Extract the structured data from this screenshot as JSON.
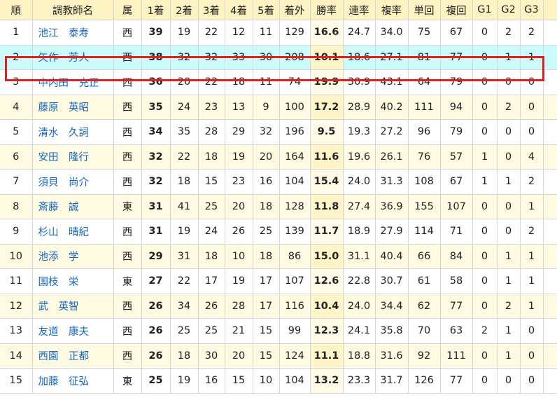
{
  "header": {
    "rank": "順",
    "trainer": "調教師名",
    "affil": "属",
    "cols": [
      "1着",
      "2着",
      "3着",
      "4着",
      "5着",
      "着外",
      "勝率",
      "連率",
      "複率",
      "単回",
      "複回",
      "G1",
      "G2",
      "G3"
    ]
  },
  "rows": [
    {
      "rank": "1",
      "name": "池江　泰寿",
      "affil": "西",
      "vals": [
        "39",
        "19",
        "22",
        "12",
        "11",
        "129",
        "16.6",
        "24.7",
        "34.0",
        "75",
        "67",
        "0",
        "2",
        "2"
      ]
    },
    {
      "rank": "2",
      "name": "矢作　芳人",
      "affil": "西",
      "vals": [
        "38",
        "32",
        "32",
        "33",
        "30",
        "208",
        "10.1",
        "18.6",
        "27.1",
        "81",
        "77",
        "0",
        "1",
        "1"
      ]
    },
    {
      "rank": "3",
      "name": "中内田　充正",
      "affil": "西",
      "vals": [
        "36",
        "20",
        "22",
        "18",
        "11",
        "74",
        "19.9",
        "30.9",
        "43.1",
        "64",
        "79",
        "0",
        "0",
        "0"
      ]
    },
    {
      "rank": "4",
      "name": "藤原　英昭",
      "affil": "西",
      "vals": [
        "35",
        "24",
        "23",
        "13",
        "9",
        "100",
        "17.2",
        "28.9",
        "40.2",
        "111",
        "94",
        "0",
        "2",
        "0"
      ]
    },
    {
      "rank": "5",
      "name": "清水　久詞",
      "affil": "西",
      "vals": [
        "34",
        "35",
        "28",
        "29",
        "32",
        "196",
        "9.5",
        "19.3",
        "27.2",
        "96",
        "79",
        "0",
        "0",
        "0"
      ]
    },
    {
      "rank": "6",
      "name": "安田　隆行",
      "affil": "西",
      "vals": [
        "32",
        "22",
        "18",
        "19",
        "20",
        "164",
        "11.6",
        "19.6",
        "26.1",
        "76",
        "57",
        "1",
        "0",
        "4"
      ]
    },
    {
      "rank": "7",
      "name": "須貝　尚介",
      "affil": "西",
      "vals": [
        "32",
        "18",
        "15",
        "23",
        "16",
        "104",
        "15.4",
        "24.0",
        "31.3",
        "108",
        "67",
        "1",
        "1",
        "2"
      ]
    },
    {
      "rank": "8",
      "name": "斎藤　誠",
      "affil": "東",
      "vals": [
        "31",
        "41",
        "25",
        "20",
        "18",
        "128",
        "11.8",
        "27.4",
        "36.9",
        "155",
        "107",
        "0",
        "0",
        "1"
      ]
    },
    {
      "rank": "9",
      "name": "杉山　晴紀",
      "affil": "西",
      "vals": [
        "31",
        "19",
        "24",
        "26",
        "25",
        "139",
        "11.7",
        "18.9",
        "27.9",
        "114",
        "71",
        "0",
        "0",
        "2"
      ]
    },
    {
      "rank": "10",
      "name": "池添　学",
      "affil": "西",
      "vals": [
        "29",
        "31",
        "18",
        "10",
        "18",
        "86",
        "15.0",
        "31.1",
        "40.4",
        "66",
        "84",
        "0",
        "1",
        "1"
      ]
    },
    {
      "rank": "11",
      "name": "国枝　栄",
      "affil": "東",
      "vals": [
        "27",
        "22",
        "17",
        "19",
        "17",
        "107",
        "12.6",
        "22.8",
        "30.7",
        "61",
        "58",
        "0",
        "1",
        "1"
      ]
    },
    {
      "rank": "12",
      "name": "武　英智",
      "affil": "西",
      "vals": [
        "26",
        "34",
        "26",
        "28",
        "17",
        "116",
        "10.4",
        "24.0",
        "34.4",
        "62",
        "77",
        "0",
        "2",
        "1"
      ]
    },
    {
      "rank": "13",
      "name": "友道　康夫",
      "affil": "西",
      "vals": [
        "26",
        "25",
        "25",
        "21",
        "15",
        "99",
        "12.3",
        "24.1",
        "35.8",
        "70",
        "63",
        "2",
        "1",
        "0"
      ]
    },
    {
      "rank": "14",
      "name": "西園　正都",
      "affil": "西",
      "vals": [
        "26",
        "18",
        "30",
        "20",
        "15",
        "124",
        "11.1",
        "18.8",
        "31.6",
        "92",
        "111",
        "0",
        "1",
        "0"
      ]
    },
    {
      "rank": "15",
      "name": "加藤　征弘",
      "affil": "東",
      "vals": [
        "25",
        "19",
        "16",
        "15",
        "10",
        "104",
        "13.2",
        "23.3",
        "31.7",
        "126",
        "77",
        "0",
        "0",
        "0"
      ]
    }
  ],
  "highlight_row": "2"
}
